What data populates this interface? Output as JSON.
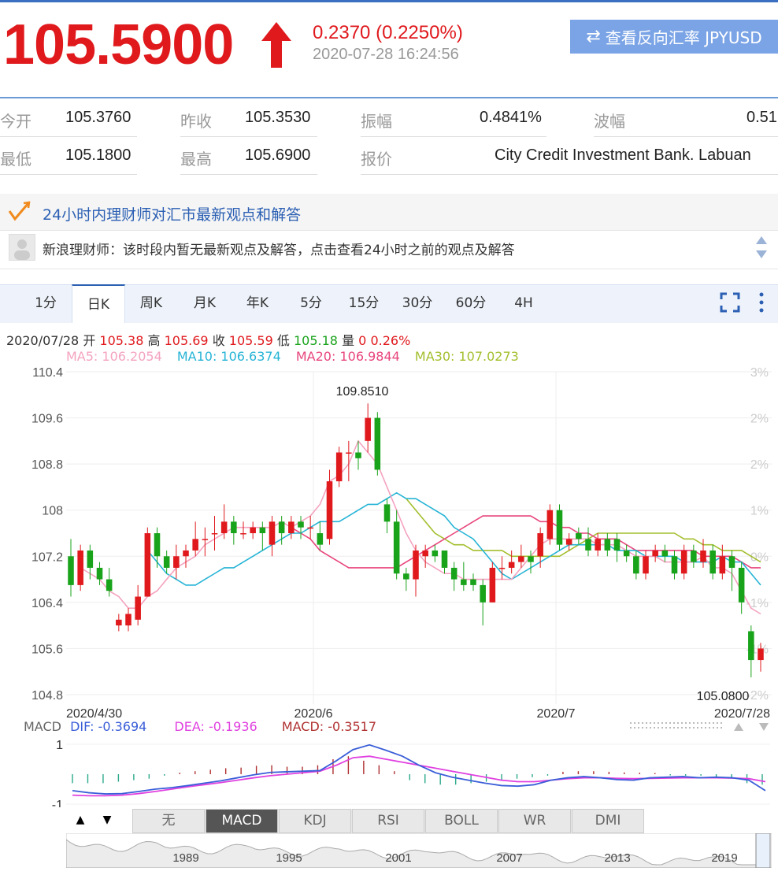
{
  "quote": {
    "price": "105.5900",
    "change": "0.2370 (0.2250%)",
    "timestamp": "2020-07-28 16:24:56",
    "reverse_button": "查看反向汇率 JPYUSD"
  },
  "stats": [
    {
      "label": "今开",
      "value": "105.3760"
    },
    {
      "label": "昨收",
      "value": "105.3530"
    },
    {
      "label": "振幅",
      "value": "0.4841%"
    },
    {
      "label": "波幅",
      "value": "0.51"
    },
    {
      "label": "最低",
      "value": "105.1800"
    },
    {
      "label": "最高",
      "value": "105.6900"
    },
    {
      "label": "报价",
      "value": "City Credit Investment Bank. Labuan"
    }
  ],
  "advice": {
    "title": "24小时内理财师对汇市最新观点和解答",
    "text": "新浪理财师：该时段内暂无最新观点及解答，点击查看24小时之前的观点及解答"
  },
  "tabs": [
    "1分",
    "日K",
    "周K",
    "月K",
    "年K",
    "5分",
    "15分",
    "30分",
    "60分",
    "4H"
  ],
  "active_tab": "日K",
  "ohlc_info": {
    "date": "2020/07/28",
    "open_label": "开",
    "open": "105.38",
    "high_label": "高",
    "high": "105.69",
    "close_label": "收",
    "close": "105.59",
    "low_label": "低",
    "low": "105.18",
    "vol_label": "量",
    "vol": "0",
    "pct": "0.26%"
  },
  "ma_legend": [
    {
      "label": "MA5: 106.2054",
      "color": "#f4a3c0"
    },
    {
      "label": "MA10: 106.6374",
      "color": "#26b4d6"
    },
    {
      "label": "MA20: 106.9844",
      "color": "#e8467c"
    },
    {
      "label": "MA30: 107.0273",
      "color": "#a3bf2e"
    }
  ],
  "macd_legend": {
    "name": "MACD",
    "dif": "DIF: -0.3694",
    "dea": "DEA: -0.1936",
    "macd": "MACD: -0.3517",
    "tick_top": "1",
    "tick_bottom": "-1"
  },
  "indicator_tabs": [
    "无",
    "MACD",
    "KDJ",
    "RSI",
    "BOLL",
    "WR",
    "DMI"
  ],
  "active_indicator": "MACD",
  "overview_years": [
    "1989",
    "1995",
    "2001",
    "2007",
    "2013",
    "2019"
  ],
  "colors": {
    "up": "#e0191d",
    "down": "#19a31b",
    "accent": "#2b5fb3"
  },
  "chart_data": {
    "type": "candlestick",
    "y_ticks": [
      "110.4",
      "109.6",
      "108.8",
      "108",
      "107.2",
      "106.4",
      "105.6",
      "104.8"
    ],
    "ylim": [
      104.8,
      110.4
    ],
    "pct_ticks": [
      "3%",
      "2%",
      "2%",
      "1%",
      "0%",
      "-1%",
      "-1%",
      "-2%"
    ],
    "x_labels": [
      "2020/4/30",
      "2020/6",
      "2020/7",
      "2020/7/28"
    ],
    "max_label": "109.8510",
    "min_label": "105.0800",
    "candles": [
      [
        107.2,
        106.7,
        107.5,
        106.5
      ],
      [
        106.7,
        107.3,
        107.4,
        106.6
      ],
      [
        107.3,
        107.0,
        107.4,
        106.8
      ],
      [
        107.0,
        106.8,
        107.1,
        106.7
      ],
      [
        106.8,
        106.6,
        107.0,
        106.5
      ],
      [
        106.0,
        106.1,
        106.2,
        105.9
      ],
      [
        106.0,
        106.2,
        106.3,
        105.9
      ],
      [
        106.1,
        106.5,
        106.7,
        106.0
      ],
      [
        106.5,
        107.6,
        107.7,
        106.5
      ],
      [
        107.6,
        107.2,
        107.7,
        107.0
      ],
      [
        107.2,
        107.0,
        107.3,
        106.9
      ],
      [
        107.0,
        107.2,
        107.4,
        106.8
      ],
      [
        107.2,
        107.3,
        107.4,
        107.0
      ],
      [
        107.3,
        107.5,
        107.8,
        107.2
      ],
      [
        107.5,
        107.5,
        107.7,
        107.2
      ],
      [
        107.6,
        107.6,
        107.9,
        107.3
      ],
      [
        107.6,
        107.8,
        108.1,
        107.5
      ],
      [
        107.8,
        107.6,
        107.9,
        107.4
      ],
      [
        107.6,
        107.6,
        107.8,
        107.5
      ],
      [
        107.6,
        107.7,
        107.8,
        107.5
      ],
      [
        107.7,
        107.6,
        107.8,
        107.3
      ],
      [
        107.4,
        107.8,
        107.9,
        107.2
      ],
      [
        107.8,
        107.6,
        107.9,
        107.4
      ],
      [
        107.6,
        107.8,
        107.9,
        107.5
      ],
      [
        107.8,
        107.7,
        107.9,
        107.5
      ],
      [
        107.7,
        107.7,
        107.9,
        107.5
      ],
      [
        107.6,
        107.4,
        107.8,
        107.3
      ],
      [
        107.5,
        108.5,
        108.7,
        107.4
      ],
      [
        108.5,
        109.0,
        109.1,
        108.4
      ],
      [
        109.0,
        109.0,
        109.2,
        108.5
      ],
      [
        109.0,
        108.9,
        109.2,
        108.7
      ],
      [
        109.2,
        109.6,
        109.85,
        109.0
      ],
      [
        109.6,
        108.7,
        109.7,
        108.6
      ],
      [
        108.1,
        107.8,
        108.2,
        107.6
      ],
      [
        107.8,
        106.9,
        108.0,
        106.8
      ],
      [
        106.9,
        106.8,
        107.0,
        106.6
      ],
      [
        106.8,
        107.3,
        107.4,
        106.5
      ],
      [
        107.2,
        107.3,
        107.4,
        107.0
      ],
      [
        107.3,
        107.2,
        107.4,
        107.1
      ],
      [
        107.3,
        107.0,
        107.3,
        106.9
      ],
      [
        107.0,
        106.8,
        107.1,
        106.6
      ],
      [
        106.8,
        106.7,
        107.1,
        106.6
      ],
      [
        106.8,
        106.7,
        106.9,
        106.6
      ],
      [
        106.7,
        106.4,
        106.8,
        106.0
      ],
      [
        106.4,
        107.0,
        107.1,
        106.4
      ],
      [
        107.0,
        107.0,
        107.2,
        106.8
      ],
      [
        107.0,
        107.1,
        107.3,
        106.9
      ],
      [
        107.1,
        107.2,
        107.4,
        107.0
      ],
      [
        107.2,
        107.1,
        107.3,
        106.9
      ],
      [
        107.2,
        107.6,
        107.7,
        107.0
      ],
      [
        107.5,
        108.0,
        108.1,
        107.4
      ],
      [
        108.0,
        107.4,
        108.1,
        107.3
      ],
      [
        107.4,
        107.5,
        107.6,
        107.3
      ],
      [
        107.6,
        107.5,
        107.7,
        107.4
      ],
      [
        107.5,
        107.3,
        107.7,
        107.2
      ],
      [
        107.3,
        107.5,
        107.6,
        107.2
      ],
      [
        107.5,
        107.3,
        107.6,
        107.2
      ],
      [
        107.5,
        107.3,
        107.6,
        107.1
      ],
      [
        107.3,
        107.2,
        107.4,
        107.1
      ],
      [
        107.2,
        106.9,
        107.3,
        106.8
      ],
      [
        106.9,
        107.2,
        107.3,
        106.8
      ],
      [
        107.2,
        107.3,
        107.4,
        107.1
      ],
      [
        107.3,
        107.2,
        107.4,
        107.1
      ],
      [
        107.2,
        106.9,
        107.3,
        106.8
      ],
      [
        106.9,
        107.3,
        107.4,
        106.8
      ],
      [
        107.3,
        107.1,
        107.4,
        107.0
      ],
      [
        107.1,
        107.3,
        107.5,
        107.0
      ],
      [
        107.3,
        106.9,
        107.4,
        106.8
      ],
      [
        106.9,
        107.2,
        107.4,
        106.8
      ],
      [
        107.2,
        107.0,
        107.3,
        106.6
      ],
      [
        107.0,
        106.4,
        107.1,
        106.2
      ],
      [
        105.9,
        105.4,
        106.0,
        105.1
      ],
      [
        105.4,
        105.6,
        105.7,
        105.2
      ]
    ],
    "ma5": [
      107.0,
      106.9,
      106.8,
      106.6,
      106.5,
      106.3,
      106.3,
      106.5,
      106.6,
      106.8,
      107.0,
      107.1,
      107.2,
      107.4,
      107.5,
      107.6,
      107.7,
      107.7,
      107.7,
      107.7,
      107.7,
      107.8,
      107.7,
      107.8,
      107.9,
      108.1,
      108.5,
      108.6,
      108.8,
      109.2,
      109.0,
      108.8,
      108.4,
      108.0,
      107.6,
      107.3,
      107.1,
      107.0,
      106.9,
      106.9,
      106.8,
      106.8,
      106.8,
      106.8,
      106.8,
      106.8,
      107.0,
      107.2,
      107.4,
      107.5,
      107.5,
      107.5,
      107.5,
      107.5,
      107.4,
      107.4,
      107.4,
      107.3,
      107.2,
      107.2,
      107.2,
      107.1,
      107.1,
      107.1,
      107.1,
      107.2,
      107.0,
      107.0,
      106.9,
      106.6,
      106.3,
      106.2
    ],
    "ma10": [
      107.3,
      107.1,
      106.9,
      106.8,
      106.7,
      106.7,
      106.8,
      106.9,
      107.0,
      107.0,
      107.1,
      107.2,
      107.3,
      107.4,
      107.5,
      107.6,
      107.6,
      107.7,
      107.8,
      107.8,
      107.8,
      107.9,
      108.0,
      108.1,
      108.1,
      108.2,
      108.3,
      108.2,
      108.2,
      108.1,
      108.0,
      107.9,
      107.7,
      107.6,
      107.5,
      107.3,
      107.1,
      106.9,
      106.8,
      106.9,
      107.0,
      107.1,
      107.2,
      107.3,
      107.4,
      107.4,
      107.4,
      107.4,
      107.4,
      107.3,
      107.3,
      107.3,
      107.2,
      107.2,
      107.2,
      107.2,
      107.1,
      107.1,
      107.1,
      107.1,
      107.2,
      107.1,
      107.1,
      106.9,
      106.7
    ],
    "ma20": [
      107.7,
      107.6,
      107.5,
      107.3,
      107.2,
      107.1,
      107.0,
      107.0,
      107.0,
      107.0,
      107.0,
      107.0,
      107.1,
      107.2,
      107.3,
      107.4,
      107.5,
      107.6,
      107.7,
      107.8,
      107.9,
      107.9,
      107.9,
      107.9,
      107.9,
      107.9,
      107.8,
      107.8,
      107.7,
      107.7,
      107.6,
      107.6,
      107.5,
      107.5,
      107.5,
      107.4,
      107.3,
      107.3,
      107.3,
      107.3,
      107.3,
      107.3,
      107.3,
      107.2,
      107.2,
      107.2,
      107.2,
      107.1,
      107.0,
      107.0
    ],
    "ma30": [
      108.2,
      108.0,
      107.8,
      107.6,
      107.5,
      107.4,
      107.4,
      107.3,
      107.3,
      107.3,
      107.3,
      107.2,
      107.2,
      107.2,
      107.2,
      107.2,
      107.2,
      107.3,
      107.4,
      107.5,
      107.6,
      107.6,
      107.6,
      107.6,
      107.6,
      107.6,
      107.6,
      107.6,
      107.6,
      107.5,
      107.5,
      107.4,
      107.4,
      107.3,
      107.3,
      107.3,
      107.2,
      107.1
    ],
    "macd_dif": [
      -0.55,
      -0.62,
      -0.66,
      -0.65,
      -0.58,
      -0.5,
      -0.45,
      -0.38,
      -0.3,
      -0.22,
      -0.12,
      -0.02,
      0.06,
      0.08,
      0.1,
      0.12,
      0.45,
      0.82,
      0.98,
      0.8,
      0.6,
      0.3,
      0.05,
      -0.1,
      -0.2,
      -0.3,
      -0.38,
      -0.4,
      -0.35,
      -0.2,
      -0.12,
      -0.08,
      -0.12,
      -0.18,
      -0.2,
      -0.12,
      -0.1,
      -0.08,
      -0.12,
      -0.1,
      -0.12,
      -0.2,
      -0.55
    ],
    "macd_dea": [
      -0.7,
      -0.72,
      -0.72,
      -0.7,
      -0.65,
      -0.58,
      -0.5,
      -0.42,
      -0.35,
      -0.28,
      -0.2,
      -0.12,
      -0.05,
      0.0,
      0.05,
      0.1,
      0.3,
      0.55,
      0.6,
      0.5,
      0.4,
      0.3,
      0.2,
      0.1,
      0.0,
      -0.1,
      -0.2,
      -0.25,
      -0.25,
      -0.2,
      -0.15,
      -0.12,
      -0.12,
      -0.14,
      -0.15,
      -0.14,
      -0.13,
      -0.12,
      -0.12,
      -0.12,
      -0.13,
      -0.15,
      -0.25
    ],
    "macd_hist": [
      -0.3,
      -0.3,
      -0.3,
      -0.25,
      -0.2,
      -0.15,
      -0.05,
      0.05,
      0.1,
      0.15,
      0.2,
      0.22,
      0.28,
      0.3,
      0.25,
      0.25,
      0.3,
      0.5,
      0.6,
      0.45,
      0.3,
      0.1,
      -0.2,
      -0.3,
      -0.35,
      -0.35,
      -0.3,
      -0.25,
      -0.2,
      -0.15,
      -0.1,
      -0.05,
      0.08,
      0.1,
      0.1,
      0.08,
      0.06,
      0.05,
      0.04,
      -0.04,
      -0.05,
      -0.05,
      -0.08,
      -0.1,
      -0.3,
      -0.35
    ]
  }
}
